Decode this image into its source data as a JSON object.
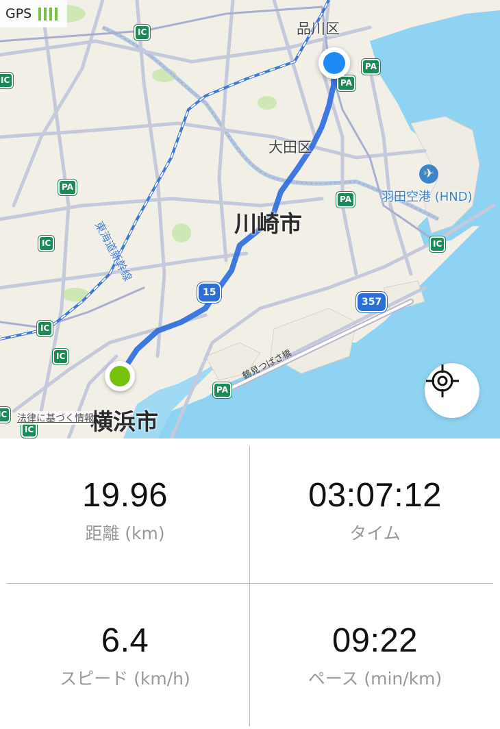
{
  "status": {
    "gps_label": "GPS",
    "gps_signal_bars": 4
  },
  "map": {
    "district_labels": [
      "品川区",
      "大田区",
      "川崎市",
      "横浜市"
    ],
    "airport_label": "羽田空港 (HND)",
    "rail_label": "東海道新幹線",
    "bridge_label": "鶴見つばさ橋",
    "highway_shields": [
      "15",
      "357"
    ],
    "interchange_badge": "IC",
    "parking_badge": "PA",
    "legal_link": "法律に基づく情報",
    "route_color": "#2f6fe0",
    "start_pin_color": "#76c20c",
    "end_pin_color": "#1e88f5",
    "locate_button_icon": "crosshair-icon"
  },
  "stats": {
    "distance": {
      "value": "19.96",
      "label": "距離 (km)"
    },
    "time": {
      "value": "03:07:12",
      "label": "タイム"
    },
    "speed": {
      "value": "6.4",
      "label": "スピード (km/h)"
    },
    "pace": {
      "value": "09:22",
      "label": "ペース (min/km)"
    }
  }
}
